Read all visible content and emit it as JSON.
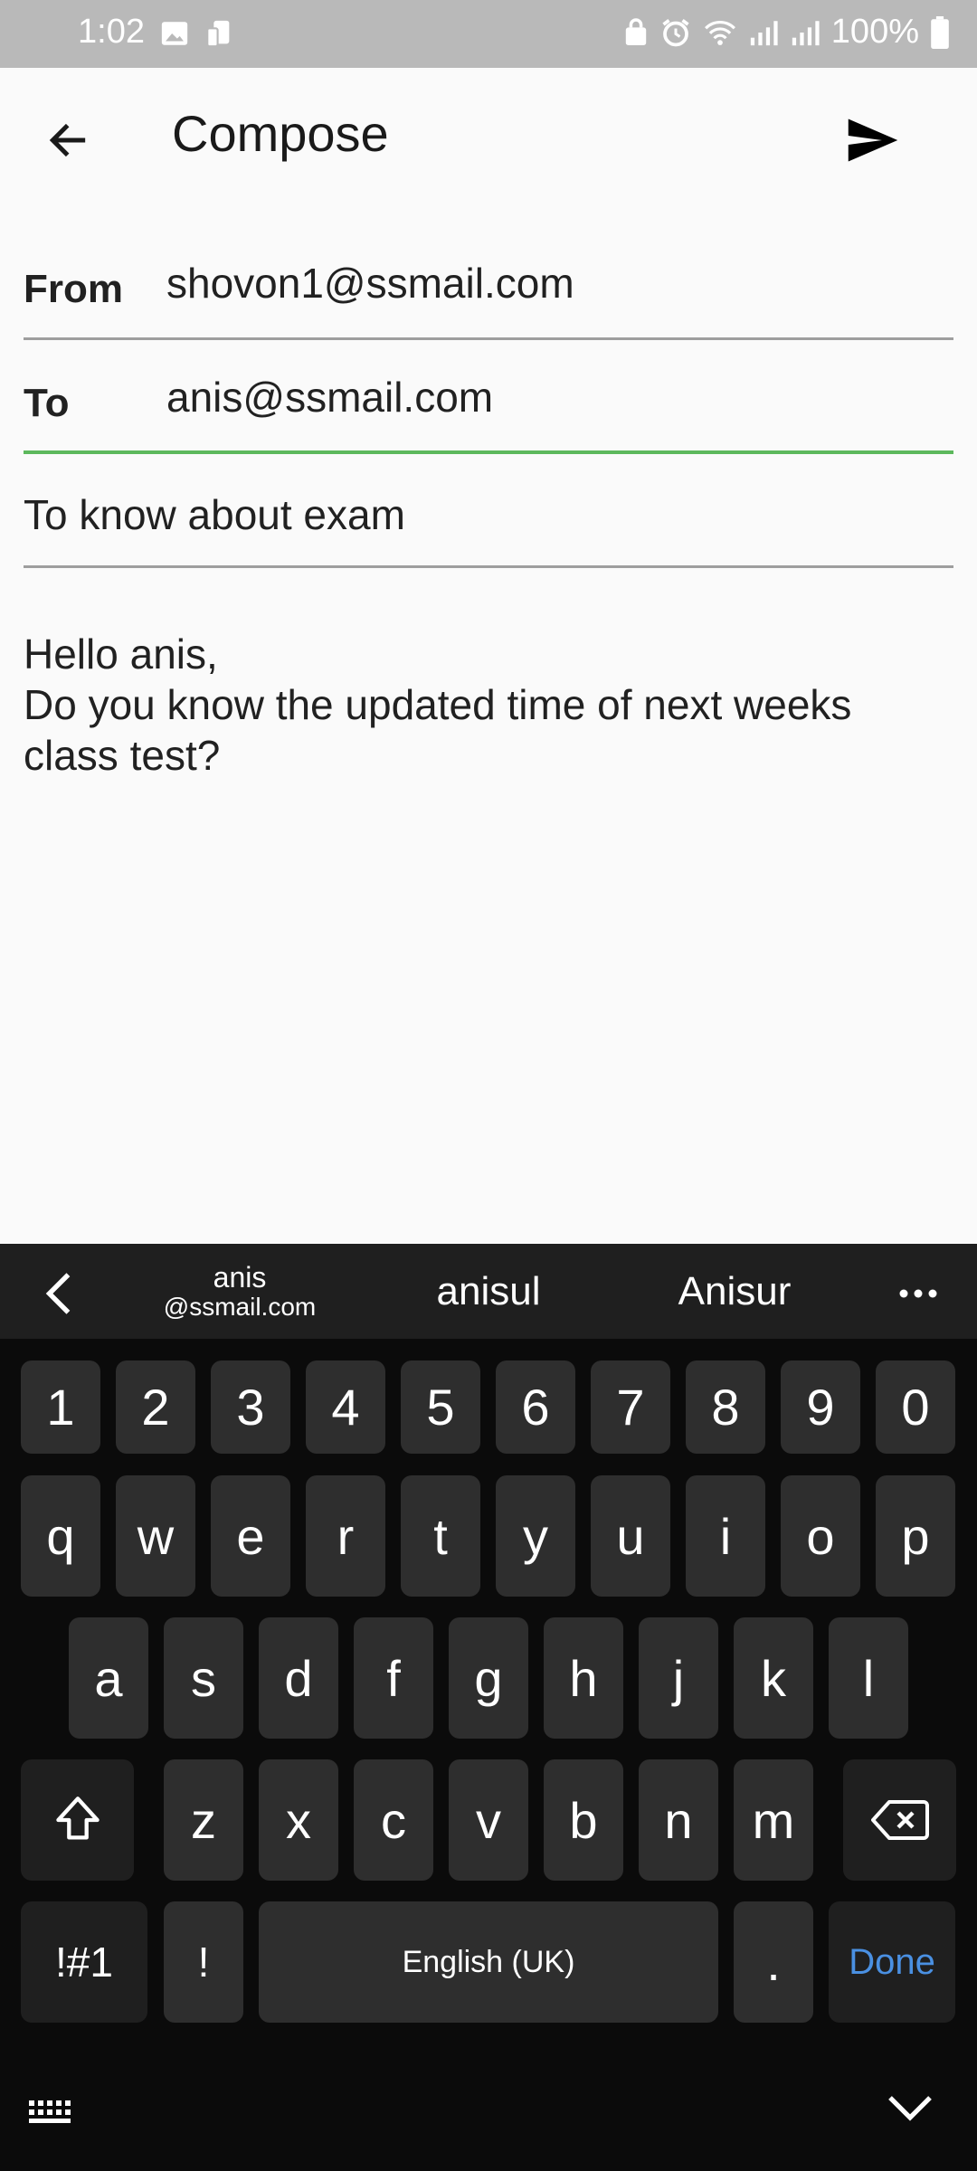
{
  "status_bar": {
    "time": "1:02",
    "battery": "100%",
    "left_icons": [
      "image-icon",
      "phone-transfer-icon"
    ],
    "right_icons": [
      "lock-icon",
      "alarm-icon",
      "wifi-icon",
      "signal-icon",
      "signal-icon",
      "battery-icon"
    ]
  },
  "app_bar": {
    "title": "Compose",
    "back_icon": "arrow-left-icon",
    "send_icon": "send-icon"
  },
  "form": {
    "from_label": "From",
    "from_value": "shovon1@ssmail.com",
    "to_label": "To",
    "to_value": "anis@ssmail.com",
    "subject_value": "To know about exam",
    "body_lines": [
      "Hello anis,",
      "Do you know the updated time of next weeks",
      "class test?"
    ]
  },
  "keyboard": {
    "suggestions": {
      "s1_line1": "anis",
      "s1_line2": "@ssmail.com",
      "s2": "anisul",
      "s3": "Anisur"
    },
    "row_numbers": [
      "1",
      "2",
      "3",
      "4",
      "5",
      "6",
      "7",
      "8",
      "9",
      "0"
    ],
    "row_q": [
      "q",
      "w",
      "e",
      "r",
      "t",
      "y",
      "u",
      "i",
      "o",
      "p"
    ],
    "row_a": [
      "a",
      "s",
      "d",
      "f",
      "g",
      "h",
      "j",
      "k",
      "l"
    ],
    "row_z": [
      "z",
      "x",
      "c",
      "v",
      "b",
      "n",
      "m"
    ],
    "sym_label": "!#1",
    "excl_label": "!",
    "space_label": "English (UK)",
    "period_label": ".",
    "done_label": "Done",
    "accent_color": "#4a90e2"
  }
}
